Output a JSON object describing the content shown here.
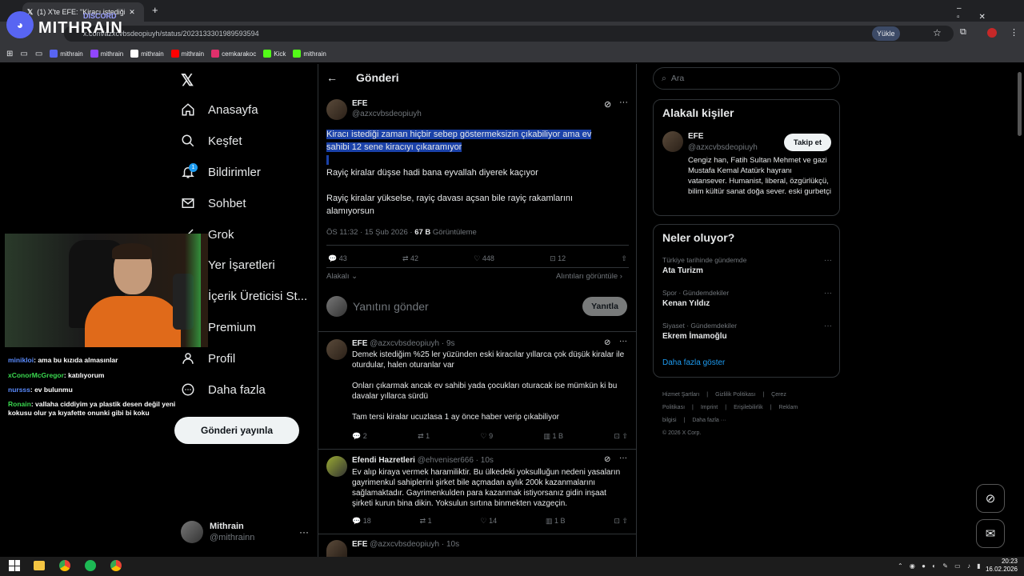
{
  "browser": {
    "tab_title": "(1) X'te EFE: \"Kiracı istediği zaman",
    "url": "x.com/azxcvbsdeopiuyh/status/2023133301989593594",
    "upload_label": "Yükle",
    "bookmarks": [
      "mithrain",
      "mithrain",
      "mithrain",
      "mithrain",
      "cemkarakoc",
      "Kick",
      "mithrain"
    ]
  },
  "overlay": {
    "brand": "MITHRAIN",
    "sub": "DISCORD"
  },
  "nav": {
    "items": [
      "Anasayfa",
      "Keşfet",
      "Bildirimler",
      "Sohbet",
      "Grok",
      "Yer İşaretleri",
      "İçerik Üreticisi St...",
      "Premium",
      "Profil",
      "Daha fazla"
    ],
    "notif_count": "1",
    "post_button": "Gönderi yayınla",
    "account_name": "Mithrain",
    "account_handle": "@mithrainn"
  },
  "chat": [
    {
      "user": "minikloi",
      "text": ": ama bu kızıda almasınlar",
      "color": "#5b8cff"
    },
    {
      "user": "xConorMcGregor",
      "text": ": katılıyorum",
      "color": "#3ad84f"
    },
    {
      "user": "nursss",
      "text": ": ev bulunmu",
      "color": "#5b8cff"
    },
    {
      "user": "Ronain",
      "text": ": vallaha ciddiyim ya plastik desen değil yeni kokusu olur ya kıyafette onunki gibi bi koku",
      "color": "#3ad84f"
    }
  ],
  "main": {
    "header_title": "Gönderi",
    "post": {
      "name": "EFE",
      "handle": "@azxcvbsdeopiuyh",
      "text1": "Kiracı istediği zaman hiçbir sebep göstermeksizin çıkabiliyor ama ev sahibi 12 sene kiracıyı çıkaramıyor",
      "text2": "Rayiç kiralar düşse hadi bana eyvallah diyerek kaçıyor",
      "text3": "Rayiç kiralar yükselse, rayiç davası açsan bile rayiç rakamlarını alamıyorsun",
      "time": "ÖS 11:32 · 15 Şub 2026 · ",
      "views": "67 B",
      "views_label": " Görüntüleme",
      "replies": "43",
      "reposts": "42",
      "likes": "448",
      "bookmarks": "12",
      "sort_label": "Alakalı",
      "quotes_label": "Alıntıları görüntüle"
    },
    "reply_placeholder": "Yanıtını gönder",
    "reply_button": "Yanıtla",
    "replies": [
      {
        "name": "EFE",
        "handle": "@azxcvbsdeopiuyh · 9s",
        "p1": "Demek istediğim %25 ler yüzünden eski kiracılar yıllarca çok düşük kiralar ile oturdular, halen oturanlar var",
        "p2": "Onları çıkarmak ancak ev sahibi yada çocukları oturacak ise mümkün ki bu davalar yıllarca sürdü",
        "p3": "Tam tersi kiralar ucuzlasa 1 ay önce haber verip çıkabiliyor",
        "replies": "2",
        "reposts": "1",
        "likes": "9",
        "views": "1 B"
      },
      {
        "name": "Efendi Hazretleri",
        "handle": "@ehveniser666 · 10s",
        "p1": "Ev alıp kiraya vermek haramiliktir. Bu ülkedeki yoksulluğun nedeni yasaların gayrimenkul sahiplerini şirket bile açmadan aylık 200k kazanmalarını sağlamaktadır. Gayrimenkulden para kazanmak istiyorsanız gidin inşaat şirketi kurun bina dikin. Yoksulun sırtına binmekten vazgeçin.",
        "replies": "18",
        "reposts": "1",
        "likes": "14",
        "views": "1 B"
      },
      {
        "name": "EFE",
        "handle": "@azxcvbsdeopiuyh · 10s"
      }
    ]
  },
  "right": {
    "search_placeholder": "Ara",
    "relevant_title": "Alakalı kişiler",
    "person_name": "EFE",
    "person_handle": "@azxcvbsdeopiuyh",
    "follow_label": "Takip et",
    "bio": "Cengiz han, Fatih Sultan Mehmet ve gazi Mustafa Kemal Atatürk hayranı vatansever. Humanist, liberal, özgürlükçü, bilim kültür sanat doğa sever. eski gurbetçi",
    "trends_title": "Neler oluyor?",
    "trends": [
      {
        "context": "Türkiye tarihinde gündemde",
        "name": "Ata Turizm"
      },
      {
        "context": "Spor · Gündemdekiler",
        "name": "Kenan Yıldız"
      },
      {
        "context": "Siyaset · Gündemdekiler",
        "name": "Ekrem İmamoğlu"
      }
    ],
    "show_more": "Daha fazla göster",
    "footer": [
      "Hizmet Şartları",
      "|",
      "Gizlilik Politikası",
      "|",
      "Çerez Politikası",
      "|",
      "Imprint",
      "|",
      "Erişilebilirlik",
      "|",
      "Reklam bilgisi",
      "|",
      "Daha fazla ···"
    ],
    "copyright": "© 2026 X Corp."
  },
  "taskbar": {
    "time": "20:23",
    "date": "16.02.2026"
  }
}
